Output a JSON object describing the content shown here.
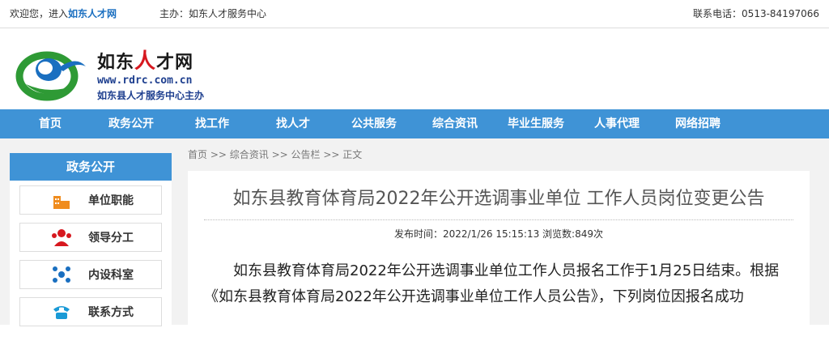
{
  "topbar": {
    "welcome_prefix": "欢迎您，进入",
    "welcome_site": "如东人才网",
    "host": "主办：如东人才服务中心",
    "phone": "联系电话：0513-84197066"
  },
  "logo": {
    "name_a": "如东",
    "name_b": "人",
    "name_c": "才网",
    "url": "www.rdrc.com.cn",
    "sub": "如东县人才服务中心主办"
  },
  "nav": {
    "items": [
      "首页",
      "政务公开",
      "找工作",
      "找人才",
      "公共服务",
      "综合资讯",
      "毕业生服务",
      "人事代理",
      "网络招聘"
    ]
  },
  "sidebar": {
    "title": "政务公开",
    "items": [
      {
        "label": "单位职能",
        "icon": "building-icon"
      },
      {
        "label": "领导分工",
        "icon": "people-icon"
      },
      {
        "label": "内设科室",
        "icon": "org-chart-icon"
      },
      {
        "label": "联系方式",
        "icon": "phone-icon"
      }
    ]
  },
  "breadcrumb": [
    "首页",
    " >> ",
    "综合资讯",
    " >> ",
    "公告栏",
    " >> ",
    "正文"
  ],
  "article": {
    "title": "如东县教育体育局2022年公开选调事业单位 工作人员岗位变更公告",
    "meta": "发布时间：2022/1/26 15:15:13 浏览数:849次",
    "body": "如东县教育体育局2022年公开选调事业单位工作人员报名工作于1月25日结束。根据《如东县教育体育局2022年公开选调事业单位工作人员公告》，下列岗位因报名成功"
  },
  "colors": {
    "accent": "#3f93d6",
    "link": "#1a6fc0",
    "brand_red": "#d7181f"
  }
}
